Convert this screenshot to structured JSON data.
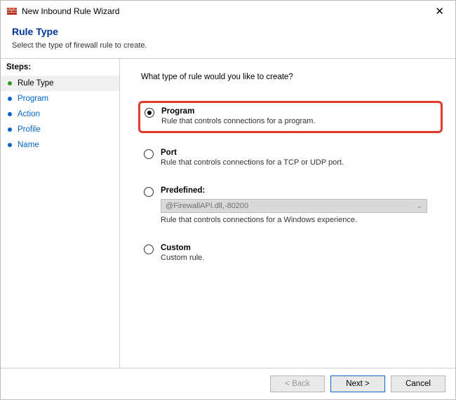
{
  "window": {
    "title": "New Inbound Rule Wizard"
  },
  "header": {
    "title": "Rule Type",
    "subtitle": "Select the type of firewall rule to create."
  },
  "sidebar": {
    "steps_label": "Steps:",
    "items": [
      {
        "label": "Rule Type",
        "current": true
      },
      {
        "label": "Program",
        "current": false
      },
      {
        "label": "Action",
        "current": false
      },
      {
        "label": "Profile",
        "current": false
      },
      {
        "label": "Name",
        "current": false
      }
    ]
  },
  "content": {
    "prompt": "What type of rule would you like to create?",
    "options": [
      {
        "id": "program",
        "label": "Program",
        "desc": "Rule that controls connections for a program.",
        "selected": true,
        "highlight": true
      },
      {
        "id": "port",
        "label": "Port",
        "desc": "Rule that controls connections for a TCP or UDP port.",
        "selected": false,
        "highlight": false
      },
      {
        "id": "predefined",
        "label": "Predefined:",
        "desc": "Rule that controls connections for a Windows experience.",
        "select_value": "@FirewallAPI.dll,-80200",
        "selected": false,
        "highlight": false
      },
      {
        "id": "custom",
        "label": "Custom",
        "desc": "Custom rule.",
        "selected": false,
        "highlight": false
      }
    ]
  },
  "footer": {
    "back": "< Back",
    "next": "Next >",
    "cancel": "Cancel"
  }
}
